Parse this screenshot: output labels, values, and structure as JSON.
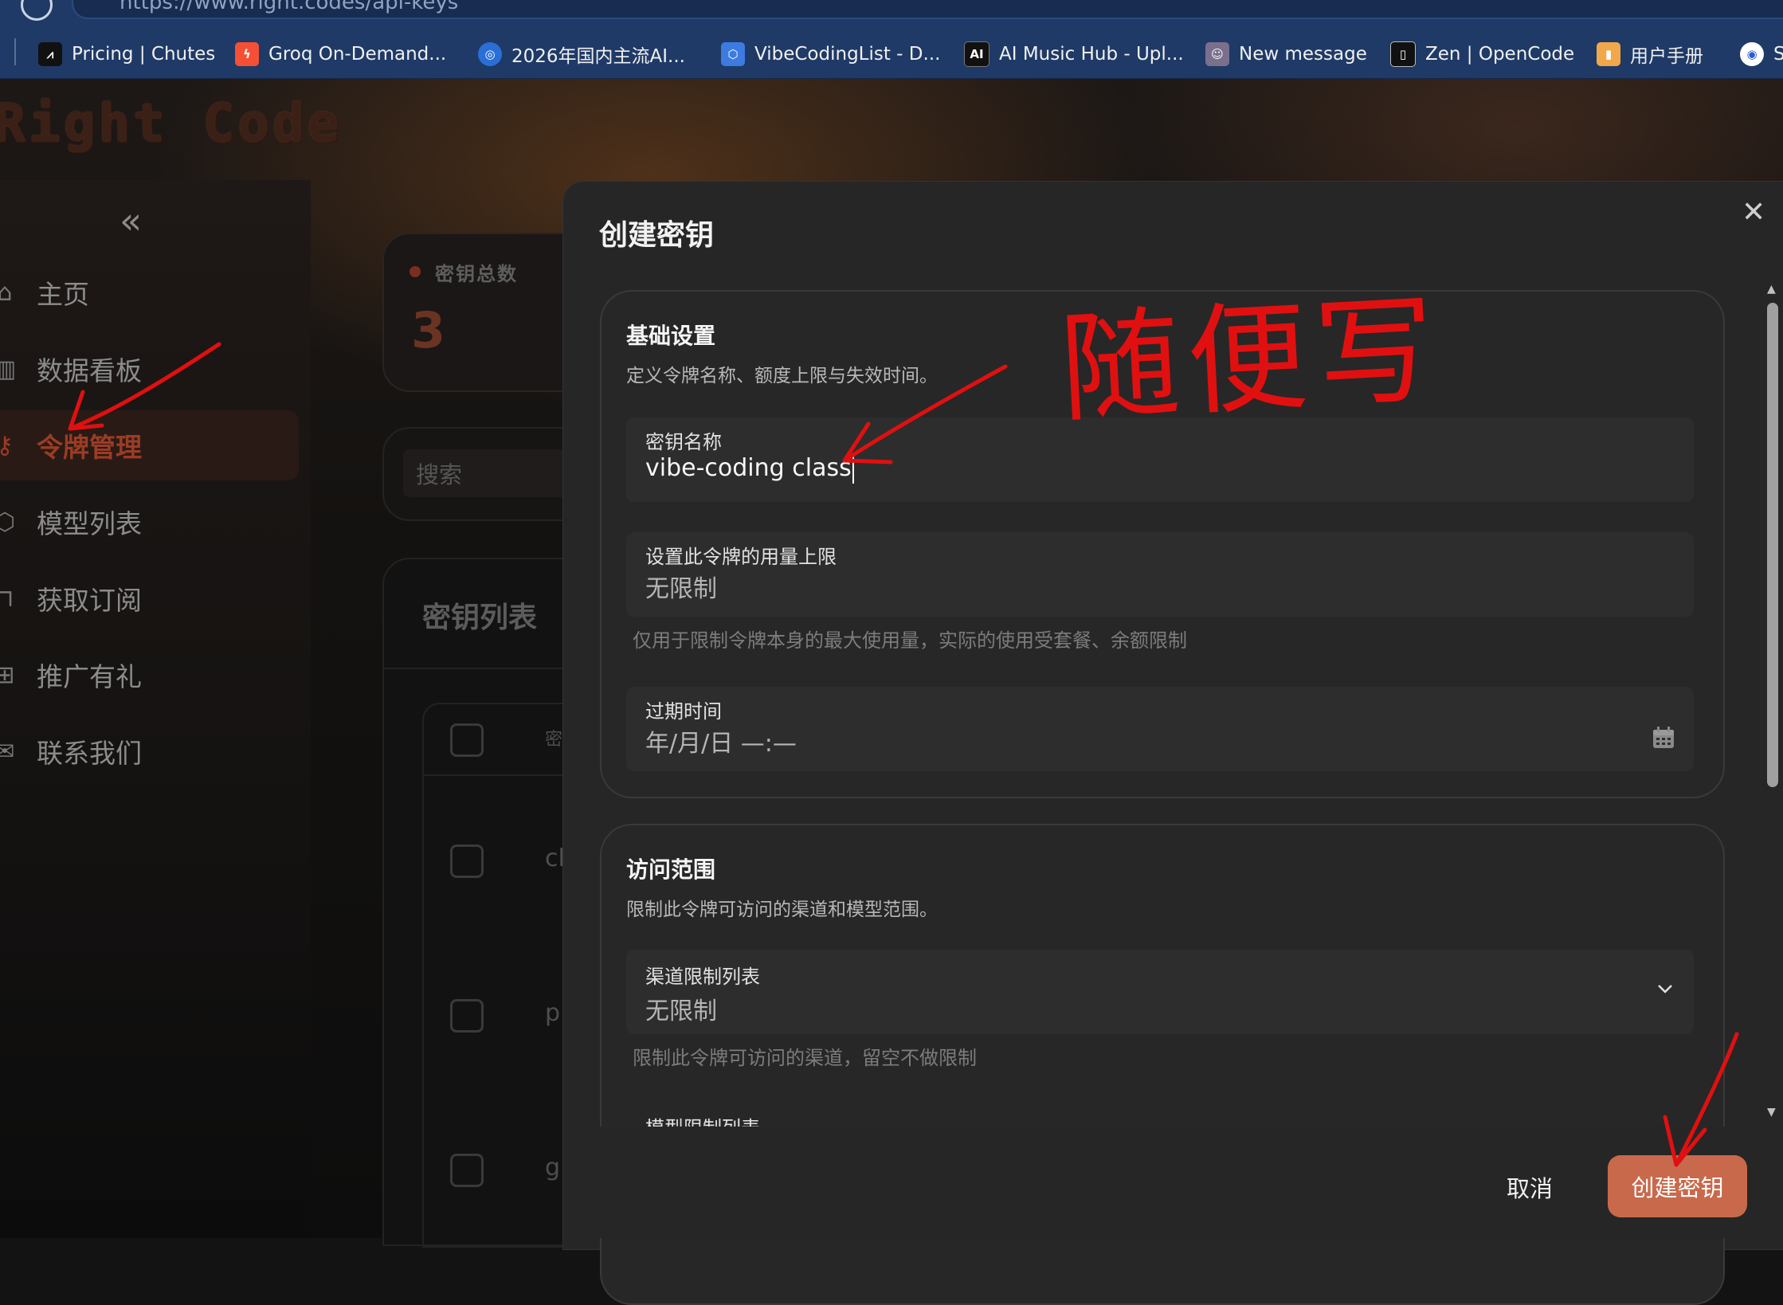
{
  "browser": {
    "url": "https://www.right.codes/api-keys",
    "bookmarks": [
      {
        "label": "Pricing | Chutes",
        "icon": "chutes-icon",
        "color": "#111111"
      },
      {
        "label": "Groq On-Demand...",
        "icon": "groq-icon",
        "color": "#f55036"
      },
      {
        "label": "2026年国内主流AI...",
        "icon": "circle-logo-icon",
        "color": "#2a6fd6"
      },
      {
        "label": "VibeCodingList - D...",
        "icon": "cube-icon",
        "color": "#3d7be0"
      },
      {
        "label": "AI Music Hub - Upl...",
        "icon": "ai-music-icon",
        "color": "#111111"
      },
      {
        "label": "New message",
        "icon": "avatar-icon",
        "color": "#7a6f8c"
      },
      {
        "label": "Zen | OpenCode",
        "icon": "opencode-icon",
        "color": "#111111"
      },
      {
        "label": "用户手册",
        "icon": "manual-icon",
        "color": "#f0a84a"
      },
      {
        "label": "S",
        "icon": "eye-logo-icon",
        "color": "#ffffff"
      }
    ]
  },
  "app": {
    "logo": "Right Code",
    "collapse_icon": "double-chevron-left-icon",
    "nav": [
      {
        "label": "主页",
        "icon": "home-icon"
      },
      {
        "label": "数据看板",
        "icon": "bar-chart-icon"
      },
      {
        "label": "令牌管理",
        "icon": "key-icon",
        "active": true
      },
      {
        "label": "模型列表",
        "icon": "cube-icon"
      },
      {
        "label": "获取订阅",
        "icon": "bag-icon"
      },
      {
        "label": "推广有礼",
        "icon": "gift-icon"
      },
      {
        "label": "联系我们",
        "icon": "mail-icon"
      }
    ],
    "stats": {
      "label": "密钥总数",
      "value": "3"
    },
    "search_placeholder": "搜索",
    "list_title": "密钥列表",
    "table_header_fragment": "密",
    "row_fragments": [
      "cl",
      "p",
      "g"
    ]
  },
  "modal": {
    "title": "创建密钥",
    "close_icon": "close-icon",
    "basic": {
      "title": "基础设置",
      "desc": "定义令牌名称、额度上限与失效时间。",
      "name_label": "密钥名称",
      "name_value": "vibe-coding class",
      "limit_label": "设置此令牌的用量上限",
      "limit_value": "无限制",
      "limit_hint": "仅用于限制令牌本身的最大使用量，实际的使用受套餐、余额限制",
      "expire_label": "过期时间",
      "expire_placeholder": "年/月/日 —:—",
      "calendar_icon": "calendar-icon"
    },
    "scope": {
      "title": "访问范围",
      "desc": "限制此令牌可访问的渠道和模型范围。",
      "channel_label": "渠道限制列表",
      "channel_value": "无限制",
      "channel_hint": "限制此令牌可访问的渠道，留空不做限制",
      "model_label": "模型限制列表",
      "dropdown_icon": "chevron-down-icon"
    },
    "cancel_label": "取消",
    "create_label": "创建密钥"
  },
  "annotation": {
    "text": "随便写",
    "color": "#e01010"
  }
}
